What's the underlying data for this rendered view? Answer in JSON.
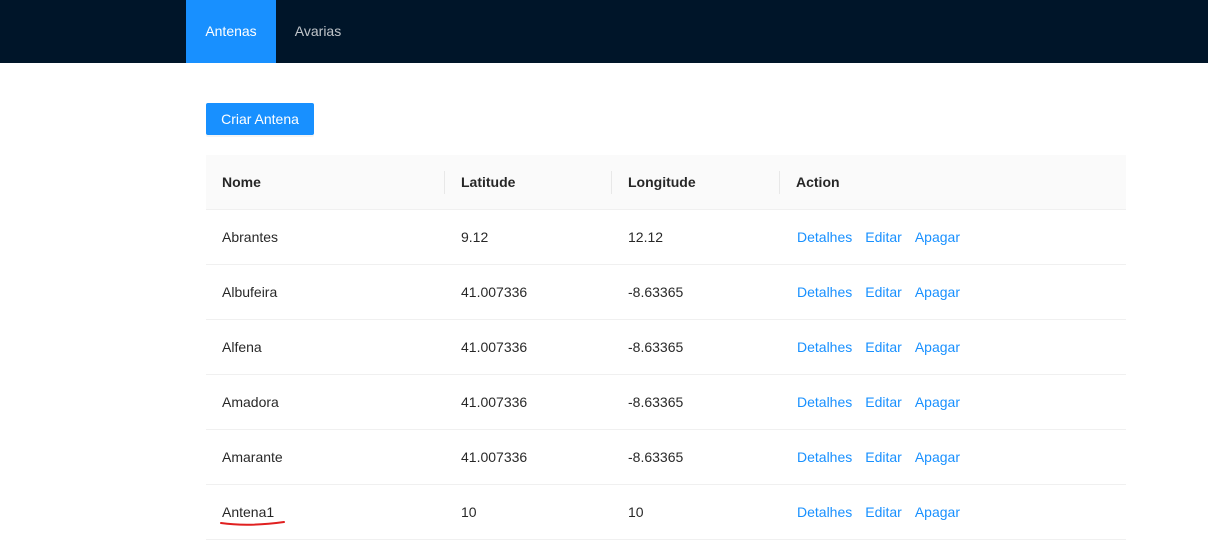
{
  "nav": {
    "items": [
      {
        "label": "Antenas",
        "active": true
      },
      {
        "label": "Avarias",
        "active": false
      }
    ]
  },
  "toolbar": {
    "create_label": "Criar Antena"
  },
  "table": {
    "columns": [
      "Nome",
      "Latitude",
      "Longitude",
      "Action"
    ],
    "action_labels": {
      "details": "Detalhes",
      "edit": "Editar",
      "delete": "Apagar"
    },
    "rows": [
      {
        "nome": "Abrantes",
        "latitude": "9.12",
        "longitude": "12.12"
      },
      {
        "nome": "Albufeira",
        "latitude": "41.007336",
        "longitude": "-8.63365"
      },
      {
        "nome": "Alfena",
        "latitude": "41.007336",
        "longitude": "-8.63365"
      },
      {
        "nome": "Amadora",
        "latitude": "41.007336",
        "longitude": "-8.63365"
      },
      {
        "nome": "Amarante",
        "latitude": "41.007336",
        "longitude": "-8.63365"
      },
      {
        "nome": "Antena1",
        "latitude": "10",
        "longitude": "10"
      }
    ]
  },
  "colors": {
    "nav_background": "#001529",
    "primary": "#1890ff",
    "header_background": "#fafafa",
    "annotation_red": "#e02020"
  }
}
